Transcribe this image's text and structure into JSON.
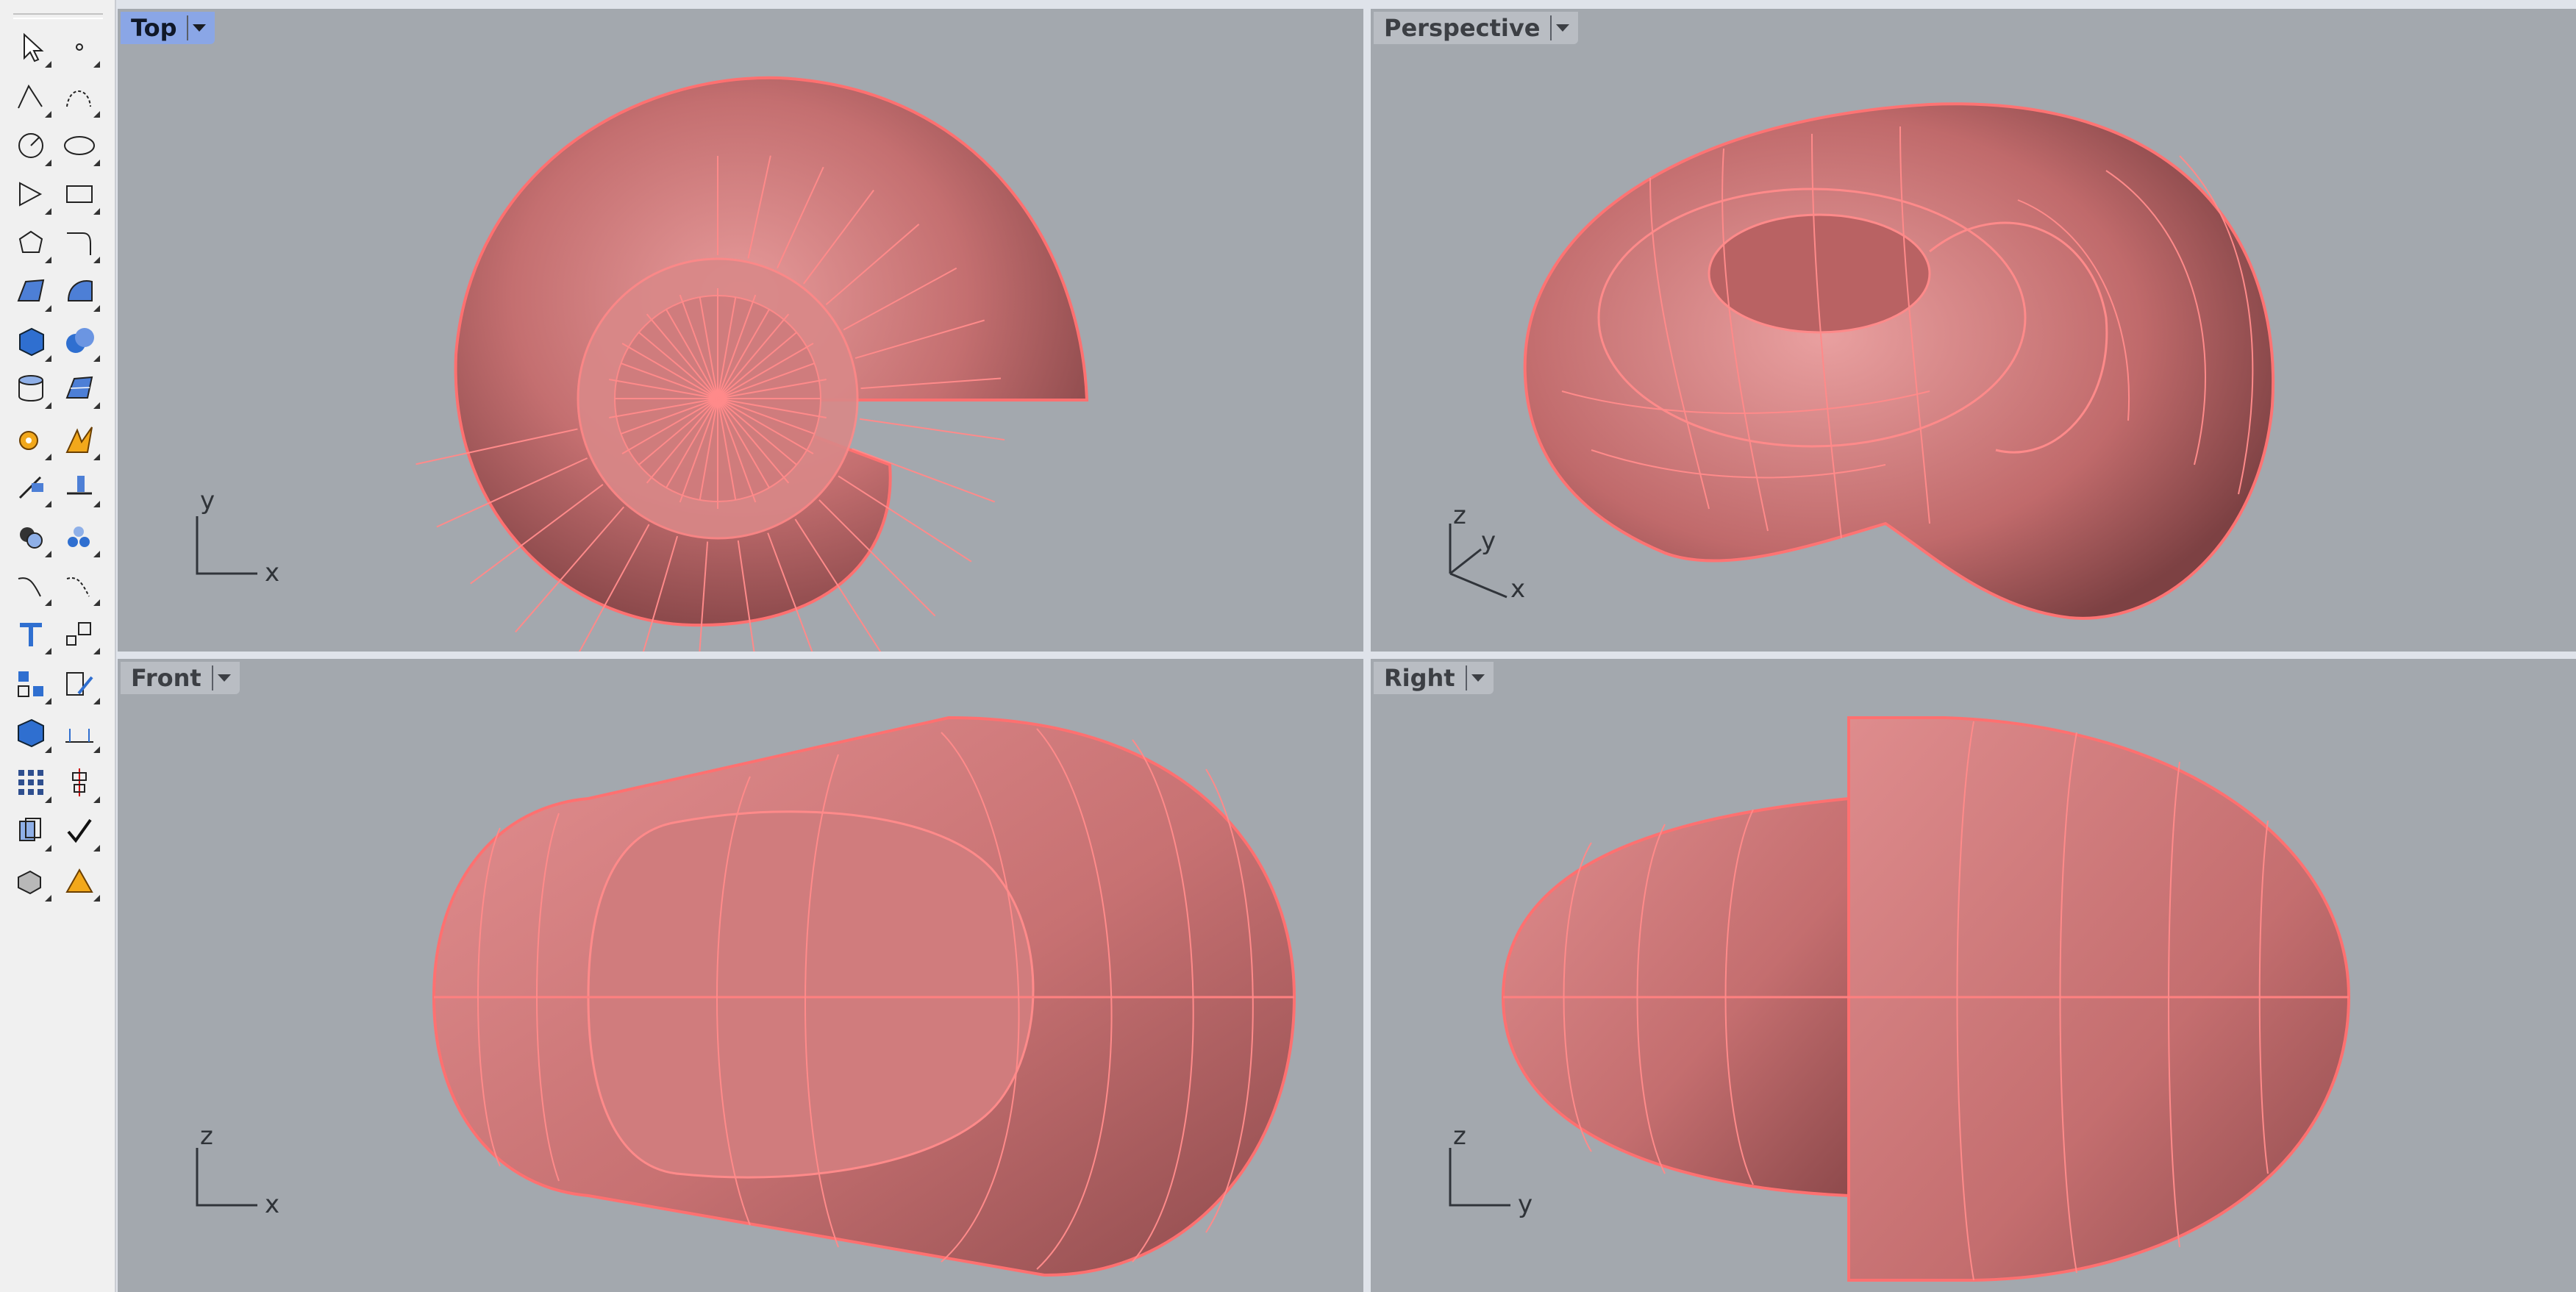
{
  "toolbar": {
    "tools": [
      [
        "select-arrow-icon",
        "point-icon"
      ],
      [
        "polyline-icon",
        "curve-control-points-icon"
      ],
      [
        "circle-icon",
        "ellipse-icon"
      ],
      [
        "polygon-arc-icon",
        "rectangle-icon"
      ],
      [
        "polygon-icon",
        "fillet-curve-icon"
      ],
      [
        "surface-from-points-icon",
        "revolve-surface-icon"
      ],
      [
        "box-solid-icon",
        "sphere-solid-icon"
      ],
      [
        "cylinder-mesh-icon",
        "mesh-plane-icon"
      ],
      [
        "boolean-gear-icon",
        "explode-icon"
      ],
      [
        "trim-icon",
        "split-icon"
      ],
      [
        "boolean-union-icon",
        "group-icon"
      ],
      [
        "offset-curve-icon",
        "blend-curve-icon"
      ],
      [
        "text-icon",
        "scale-icon"
      ],
      [
        "block-icon",
        "edit-icon"
      ],
      [
        "layer-box-icon",
        "dimension-icon"
      ],
      [
        "array-icon",
        "align-icon"
      ],
      [
        "copy-icon",
        "check-icon"
      ],
      [
        "render-icon",
        "material-icon"
      ]
    ]
  },
  "viewports": [
    {
      "id": "top",
      "title": "Top",
      "active": true,
      "axes": [
        "y",
        "x"
      ]
    },
    {
      "id": "perspective",
      "title": "Perspective",
      "active": false,
      "axes": [
        "z",
        "y",
        "x"
      ]
    },
    {
      "id": "front",
      "title": "Front",
      "active": false,
      "axes": [
        "z",
        "x"
      ]
    },
    {
      "id": "right",
      "title": "Right",
      "active": false,
      "axes": [
        "z",
        "y"
      ]
    }
  ],
  "colors": {
    "viewport_bg": "#a3a8ae",
    "shell_fill": "#c26a6a",
    "wire": "#ff8080",
    "active_title": "#8aa6e6"
  }
}
